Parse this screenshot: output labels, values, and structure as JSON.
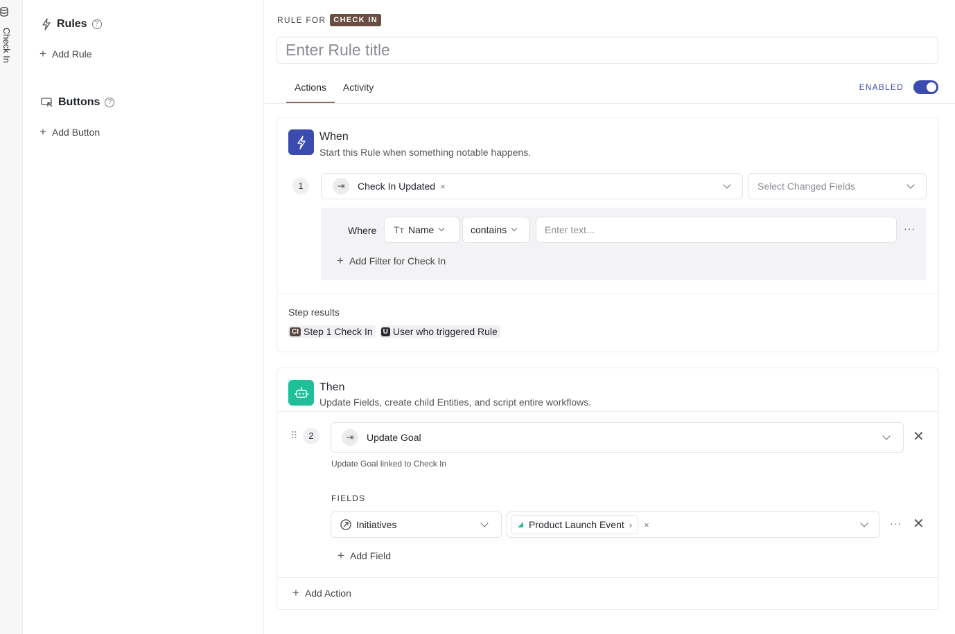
{
  "side_strip": {
    "label": "Check In"
  },
  "nav": {
    "rules_heading": "Rules",
    "add_rule": "Add Rule",
    "buttons_heading": "Buttons",
    "add_button": "Add Button",
    "help_glyph": "?"
  },
  "header": {
    "rule_for": "RULE FOR",
    "entity_badge": "CHECK IN",
    "title_placeholder": "Enter Rule title",
    "title_value": ""
  },
  "tabs": [
    {
      "label": "Actions",
      "active": true
    },
    {
      "label": "Activity",
      "active": false
    }
  ],
  "enabled": {
    "label": "ENABLED",
    "on": true
  },
  "when": {
    "title": "When",
    "subtitle": "Start this Rule when something notable happens.",
    "step_number": "1",
    "trigger": "Check In Updated",
    "changed_fields_placeholder": "Select Changed Fields",
    "filter": {
      "where_label": "Where",
      "field": "Name",
      "field_icon": "Tт",
      "operator": "contains",
      "value_placeholder": "Enter text...",
      "add_filter": "Add Filter for Check In"
    },
    "results_label": "Step results",
    "results": [
      {
        "badge": "CI",
        "label": "Step 1 Check In"
      },
      {
        "badge": "U",
        "label": "User who triggered Rule"
      }
    ]
  },
  "then": {
    "title": "Then",
    "subtitle": "Update Fields, create child Entities, and script entire workflows.",
    "step_number": "2",
    "action": "Update Goal",
    "action_hint": "Update Goal linked to Check In",
    "fields_label": "FIELDS",
    "field_name": "Initiatives",
    "field_value": "Product Launch Event",
    "add_field": "Add Field",
    "add_action": "Add Action"
  },
  "colors": {
    "accent": "#3b4bb0",
    "when_icon_bg": "#3b4bb0",
    "then_icon_bg": "#1fbf9a",
    "entity_badge_bg": "#6b4d44"
  },
  "icons": {
    "trigger_icon": "arrow-to-line-icon",
    "then_icon": "robot-icon",
    "when_icon": "lightning-icon"
  }
}
